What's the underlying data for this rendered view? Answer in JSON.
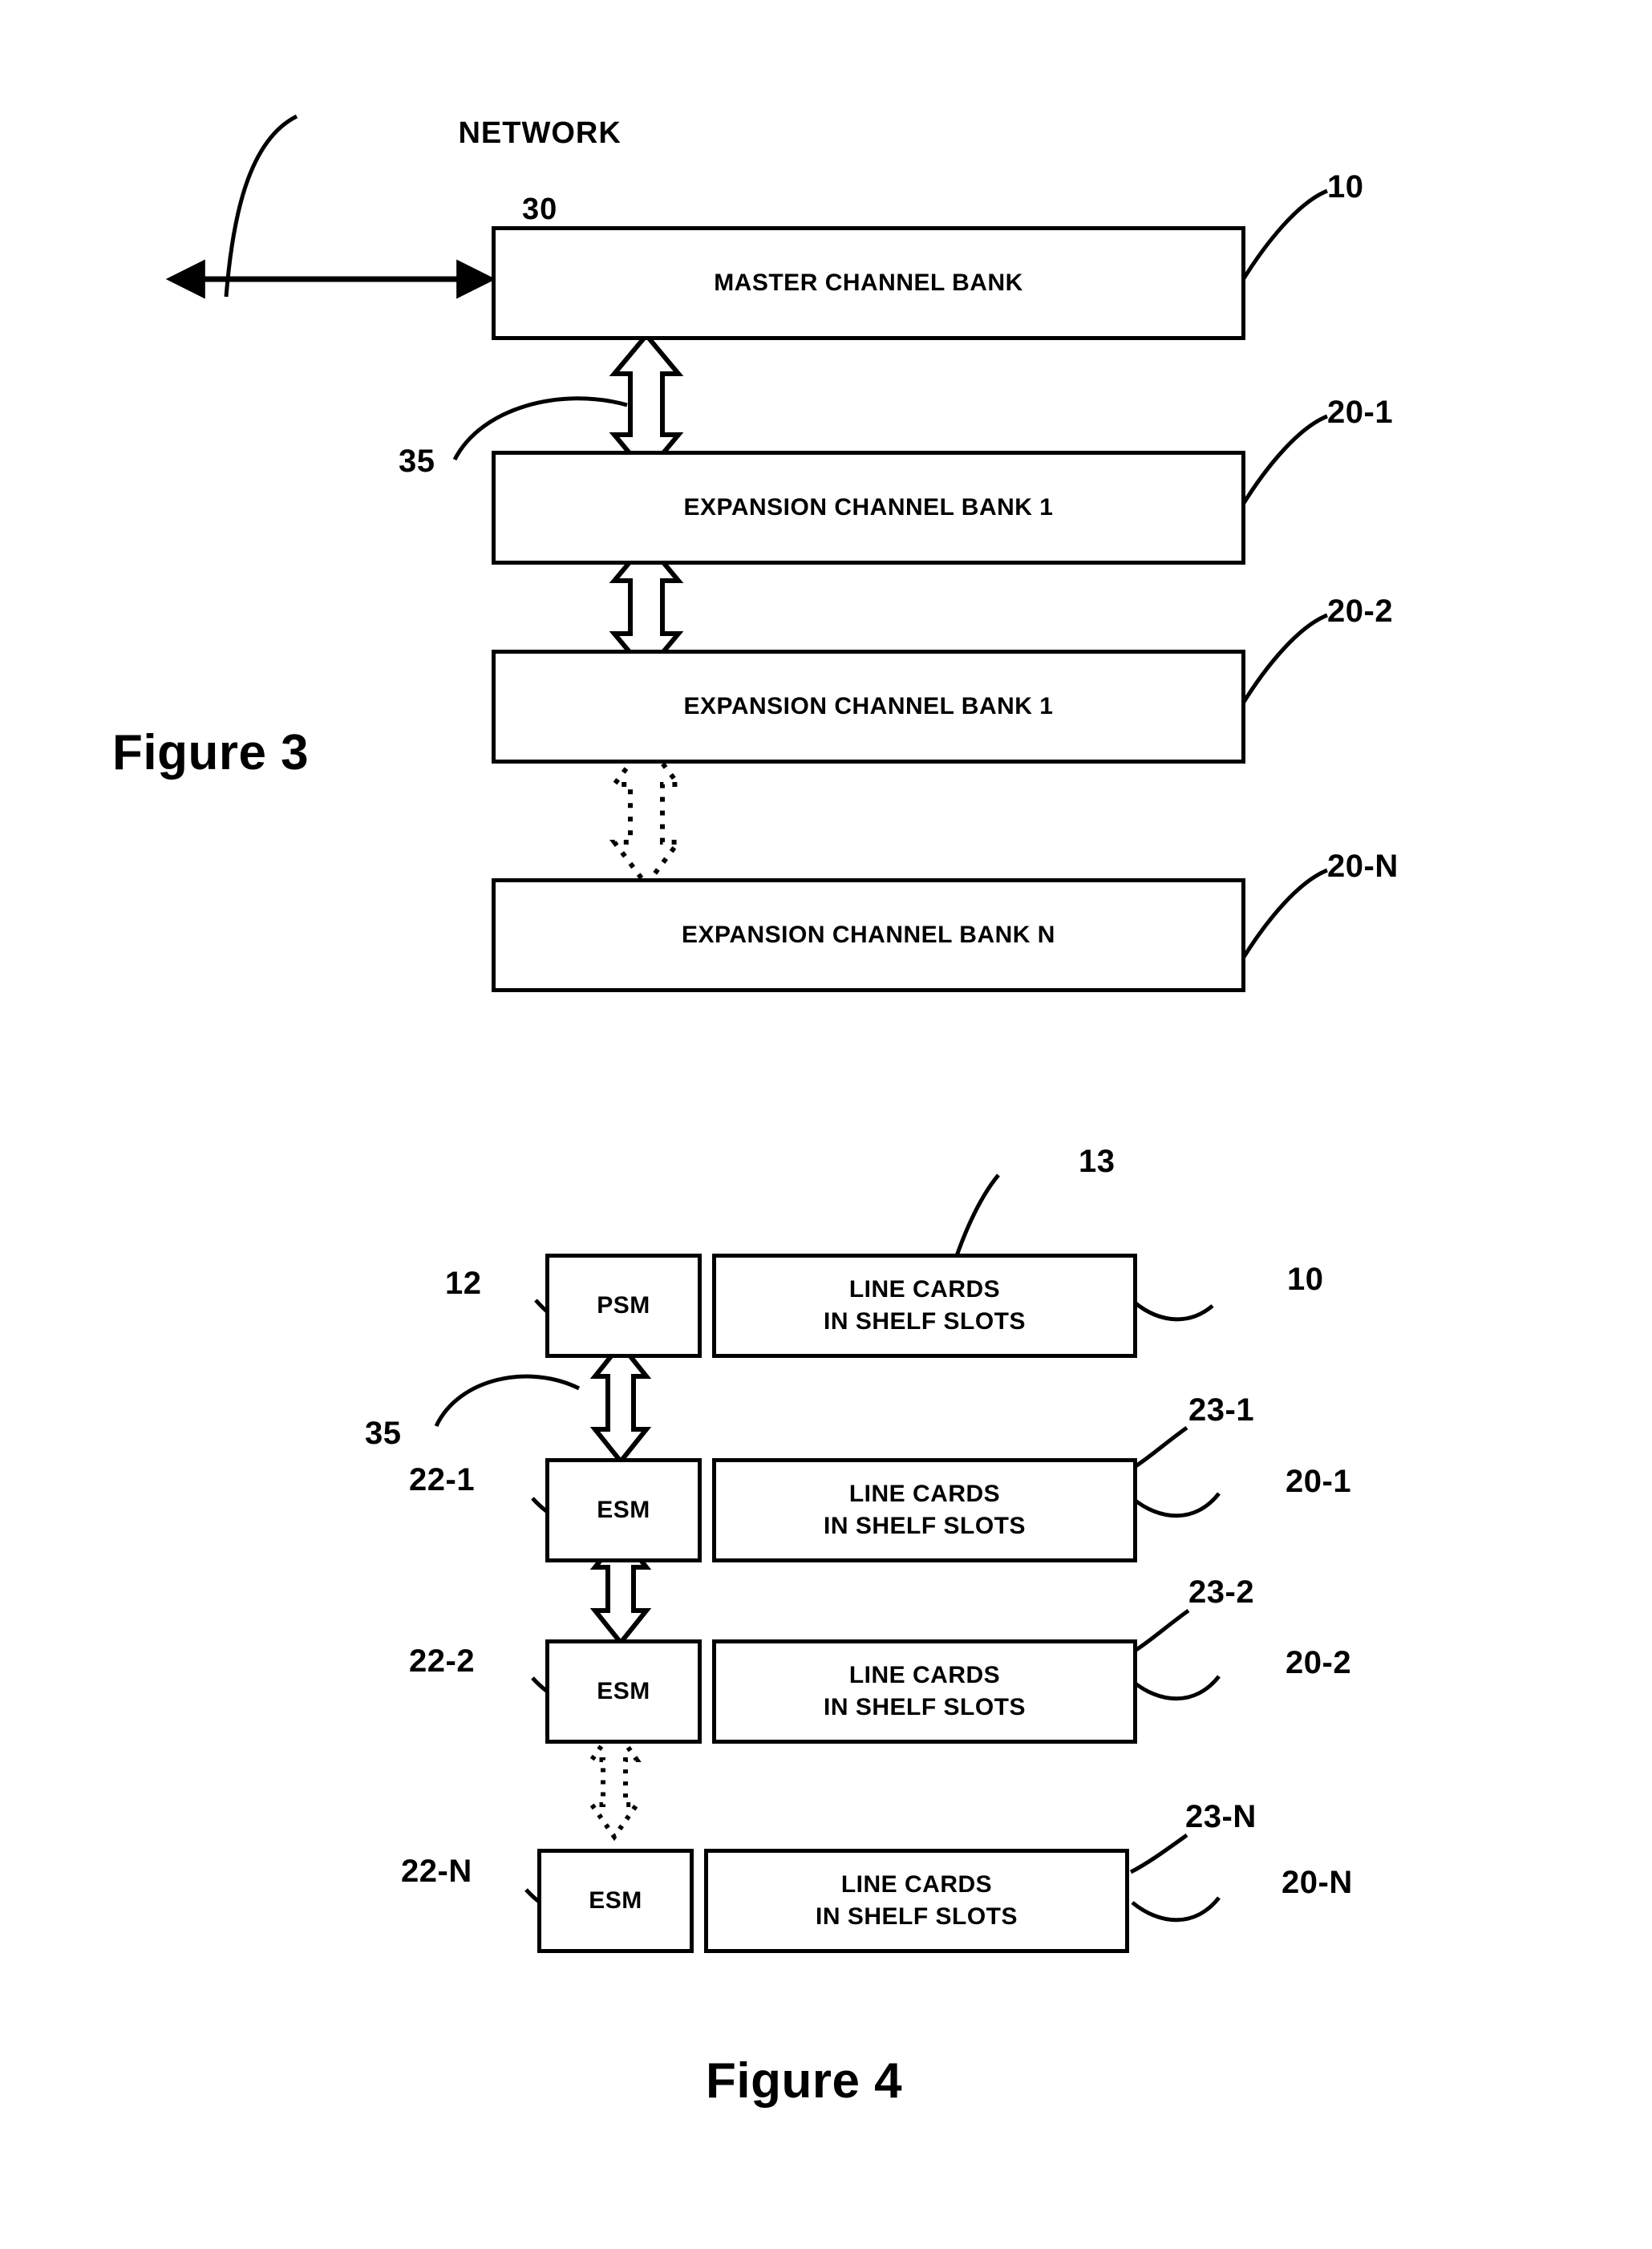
{
  "figure3": {
    "caption": "Figure 3",
    "network_label_line1": "NETWORK",
    "network_label_line2": "30",
    "link_ref": "35",
    "boxes": [
      {
        "label": "MASTER CHANNEL BANK",
        "ref": "10"
      },
      {
        "label": "EXPANSION CHANNEL BANK 1",
        "ref": "20-1"
      },
      {
        "label": "EXPANSION CHANNEL BANK 1",
        "ref": "20-2"
      },
      {
        "label": "EXPANSION CHANNEL BANK N",
        "ref": "20-N"
      }
    ],
    "connectors": [
      {
        "style": "solid"
      },
      {
        "style": "solid"
      },
      {
        "style": "dotted"
      }
    ]
  },
  "figure4": {
    "caption": "Figure 4",
    "link_ref": "35",
    "rows": [
      {
        "module_label": "PSM",
        "module_ref": "12",
        "cards_line1": "LINE CARDS",
        "cards_line2": "IN SHELF SLOTS",
        "cards_ref": "13",
        "shelf_ref": "10"
      },
      {
        "module_label": "ESM",
        "module_ref": "22-1",
        "cards_line1": "LINE CARDS",
        "cards_line2": "IN SHELF SLOTS",
        "cards_ref": "23-1",
        "shelf_ref": "20-1"
      },
      {
        "module_label": "ESM",
        "module_ref": "22-2",
        "cards_line1": "LINE CARDS",
        "cards_line2": "IN SHELF SLOTS",
        "cards_ref": "23-2",
        "shelf_ref": "20-2"
      },
      {
        "module_label": "ESM",
        "module_ref": "22-N",
        "cards_line1": "LINE CARDS",
        "cards_line2": "IN SHELF SLOTS",
        "cards_ref": "23-N",
        "shelf_ref": "20-N"
      }
    ],
    "connectors": [
      {
        "style": "solid"
      },
      {
        "style": "solid"
      },
      {
        "style": "dotted"
      }
    ]
  },
  "colors": {
    "ink": "#000000",
    "paper": "#ffffff"
  }
}
